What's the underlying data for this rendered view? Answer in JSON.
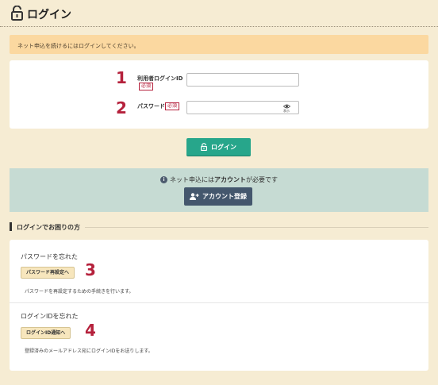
{
  "header": {
    "title": "ログイン",
    "icon": "unlock-icon"
  },
  "notice": {
    "text": "ネット申込を続けるにはログインしてください。"
  },
  "form": {
    "userid": {
      "number": "1",
      "label": "利用者ログインID",
      "required": "必須",
      "value": ""
    },
    "password": {
      "number": "2",
      "label": "パスワード",
      "required": "必須",
      "value": "",
      "toggle_label": "表示",
      "toggle_icon": "eye-icon"
    }
  },
  "login_button": {
    "label": "ログイン",
    "icon": "unlock-icon"
  },
  "signup": {
    "message_prefix": "ネット申込には",
    "message_bold": "アカウント",
    "message_suffix": "が必要です",
    "button_label": "アカウント登録",
    "button_icon": "user-plus-icon",
    "info_icon": "info-icon"
  },
  "trouble": {
    "heading": "ログインでお困りの方",
    "password_help": {
      "title": "パスワードを忘れた",
      "button": "パスワード再設定へ",
      "number": "3",
      "description": "パスワードを再設定するための手続きを行います。"
    },
    "id_help": {
      "title": "ログインIDを忘れた",
      "button": "ログインID通知へ",
      "number": "4",
      "description": "登録済みのメールアドレス宛にログインIDをお送りします。"
    }
  },
  "colors": {
    "background": "#f6ecd3",
    "notice": "#fbd8a0",
    "login_button": "#27a68b",
    "signup_box": "#c6dbd3",
    "signup_button": "#44576d",
    "annotation_number": "#b5213c"
  }
}
